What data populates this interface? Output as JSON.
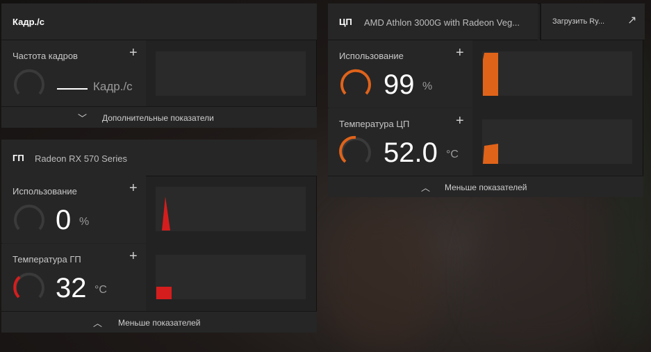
{
  "fps_panel": {
    "title": "Кадр./с",
    "row": {
      "label": "Частота кадров",
      "value": "—",
      "unit": "Кадр./с"
    },
    "footer": "Дополнительные показатели"
  },
  "gpu_panel": {
    "tag": "ГП",
    "name": "Radeon RX 570 Series",
    "rows": [
      {
        "label": "Использование",
        "value": "0",
        "unit": "%",
        "level": 0.0
      },
      {
        "label": "Температура ГП",
        "value": "32",
        "unit": "°C",
        "level": 0.32
      }
    ],
    "footer": "Меньше показателей"
  },
  "cpu_panel": {
    "tag": "ЦП",
    "name": "AMD Athlon 3000G with Radeon Veg...",
    "load_button": "Загрузить Ry...",
    "rows": [
      {
        "label": "Использование",
        "value": "99",
        "unit": "%",
        "level": 0.99
      },
      {
        "label": "Температура ЦП",
        "value": "52.0",
        "unit": "°C",
        "level": 0.52
      }
    ],
    "footer": "Меньше показателей"
  },
  "colors": {
    "accent_orange": "#e0631a",
    "accent_red": "#d61d1d",
    "gauge_track": "#3a3a3a"
  },
  "icons": {
    "add": "plus-icon",
    "expand": "chevron-down-icon",
    "collapse": "chevron-up-icon",
    "pop_out": "arrow-up-right-icon"
  }
}
